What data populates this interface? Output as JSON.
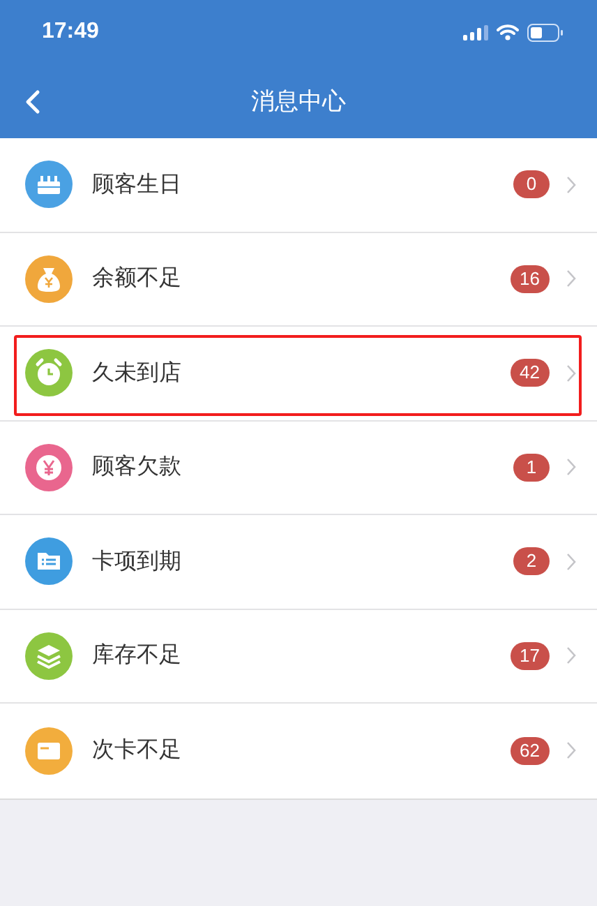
{
  "status_bar": {
    "time": "17:49"
  },
  "nav_bar": {
    "title": "消息中心"
  },
  "items": [
    {
      "label": "顾客生日",
      "count": "0",
      "kind": "cake",
      "color": "#4aa1e3",
      "highlighted": false
    },
    {
      "label": "余额不足",
      "count": "16",
      "kind": "money-bag",
      "color": "#f0a73c",
      "highlighted": false
    },
    {
      "label": "久未到店",
      "count": "42",
      "kind": "clock",
      "color": "#8dc641",
      "highlighted": true
    },
    {
      "label": "顾客欠款",
      "count": "1",
      "kind": "yen",
      "color": "#e9668e",
      "highlighted": false
    },
    {
      "label": "卡项到期",
      "count": "2",
      "kind": "folder",
      "color": "#3f9de0",
      "highlighted": false
    },
    {
      "label": "库存不足",
      "count": "17",
      "kind": "layers",
      "color": "#8dc641",
      "highlighted": false
    },
    {
      "label": "次卡不足",
      "count": "62",
      "kind": "card",
      "color": "#f2ad3d",
      "highlighted": false
    }
  ]
}
